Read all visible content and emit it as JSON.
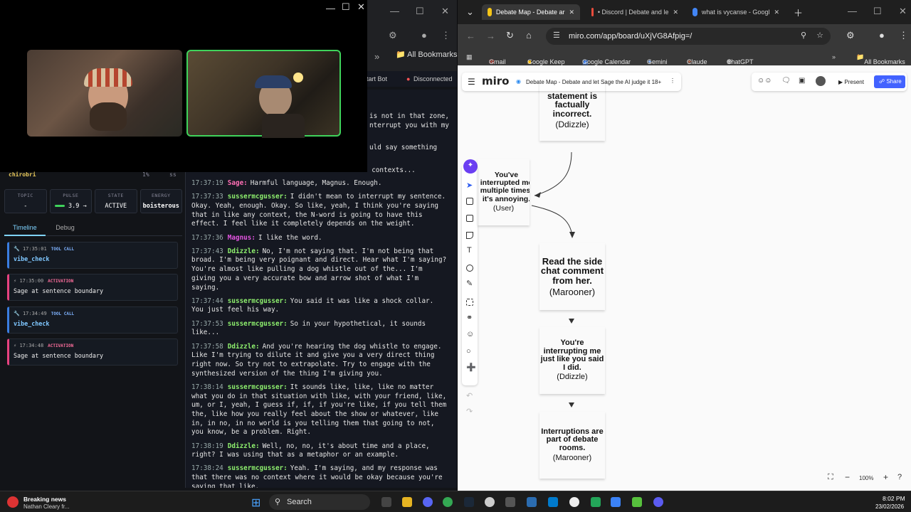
{
  "call": {
    "participant_label": "chirobri",
    "participant_meta1": "1%",
    "participant_meta2": "ss"
  },
  "left_browser": {
    "bookmarks_label": "All Bookmarks"
  },
  "app": {
    "start_bot_label": "tart Bot",
    "status": "Disconnected",
    "stats": [
      {
        "key": "TOPIC",
        "value": "-"
      },
      {
        "key": "PULSE",
        "value": "3.9 →"
      },
      {
        "key": "STATE",
        "value": "ACTIVE"
      },
      {
        "key": "ENERGY",
        "value": "boisterous"
      }
    ],
    "tabs": [
      "Timeline",
      "Debug"
    ],
    "events": [
      {
        "time": "17:35:01",
        "tag": "TOOL CALL",
        "body": "vibe_check",
        "kind": "tool"
      },
      {
        "time": "17:35:00",
        "tag": "ACTIVATION",
        "body": "Sage at sentence boundary",
        "kind": "act"
      },
      {
        "time": "17:34:49",
        "tag": "TOOL CALL",
        "body": "vibe_check",
        "kind": "tool"
      },
      {
        "time": "17:34:48",
        "tag": "ACTIVATION",
        "body": "Sage at sentence boundary",
        "kind": "act"
      }
    ],
    "chat_partial": [
      "is not in that zone,",
      "nterrupt you with my",
      "uld say something",
      "n contexts..."
    ],
    "chat": [
      {
        "time": "17:37:19",
        "speaker": "Sage:",
        "color": "pink",
        "text": "Harmful language, Magnus. Enough."
      },
      {
        "time": "17:37:33",
        "speaker": "sussermcgusser:",
        "color": "green",
        "text": "I didn't mean to interrupt my sentence. Okay. Yeah, enough. Okay. So like, yeah, I think you're saying that in like any context, the N-word is going to have this effect. I feel like it completely depends on the weight."
      },
      {
        "time": "17:37:36",
        "speaker": "Magnus:",
        "color": "mag",
        "text": "I like the word."
      },
      {
        "time": "17:37:43",
        "speaker": "Ddizzle:",
        "color": "green",
        "text": "No, I'm not saying that. I'm not being that broad. I'm being very poignant and direct. Hear what I'm saying? You're almost like pulling a dog whistle out of the... I'm giving you a very accurate bow and arrow shot of what I'm saying."
      },
      {
        "time": "17:37:44",
        "speaker": "sussermcgusser:",
        "color": "green",
        "text": "You said it was like a shock collar. You just feel his way."
      },
      {
        "time": "17:37:53",
        "speaker": "sussermcgusser:",
        "color": "green",
        "text": "So in your hypothetical, it sounds like..."
      },
      {
        "time": "17:37:58",
        "speaker": "Ddizzle:",
        "color": "green",
        "text": "And you're hearing the dog whistle to engage. Like I'm trying to dilute it and give you a very direct thing right now. So try not to extrapolate. Try to engage with the synthesized version of the thing I'm giving you."
      },
      {
        "time": "17:38:14",
        "speaker": "sussermcgusser:",
        "color": "green",
        "text": "It sounds like, like, like no matter what you do in that situation with like, with your friend, like, um, or I, yeah, I guess if, if, if you're like, if you tell them the, like how you really feel about the show or whatever, like in, in no, in no world is you telling them that going to not, you know, be a problem. Right."
      },
      {
        "time": "17:38:19",
        "speaker": "Ddizzle:",
        "color": "green",
        "text": "Well, no, no, it's about time and a place, right? I was using that as a metaphor or an example."
      },
      {
        "time": "17:38:24",
        "speaker": "sussermcgusser:",
        "color": "green",
        "text": "Yeah. I'm saying, and my response was that there was no context where it would be okay because you're saying that like,"
      }
    ]
  },
  "right_browser": {
    "tabs": [
      {
        "label": "Debate Map - Debate ar",
        "color": "#f5c518"
      },
      {
        "label": "• Discord | Debate and le",
        "color": "#e74c3c"
      },
      {
        "label": "what is vycanse - Googl",
        "color": "#4285f4"
      }
    ],
    "url": "miro.com/app/board/uXjVG8Afpig=/",
    "bookmarks": [
      "Gmail",
      "Google Keep",
      "Google Calendar",
      "Gemini",
      "Claude",
      "ChatGPT",
      "All Bookmarks"
    ],
    "miro": {
      "logo": "miro",
      "board_title": "Debate Map - Debate and let Sage the AI judge it 18+",
      "present_label": "Present",
      "share_label": "Share",
      "zoom": "100%",
      "notes": [
        {
          "text": "statement is factually incorrect.",
          "author": "(Ddizzle)",
          "color": "#fff28c"
        },
        {
          "text": "You've interrupted me multiple times, it's annoying.",
          "author": "(User)",
          "color": "#f59ee8"
        },
        {
          "text": "Read the side chat comment from her.",
          "author": "(Marooner)",
          "color": "#f7b26b"
        },
        {
          "text": "You're interrupting me just like you said I did.",
          "author": "(Ddizzle)",
          "color": "#fff28c"
        },
        {
          "text": "Interruptions are part of debate rooms.",
          "author": "(Marooner)",
          "color": "#f7b26b"
        }
      ]
    }
  },
  "taskbar": {
    "news_title": "Breaking news",
    "news_sub": "Nathan Cleary fr...",
    "search_label": "Search",
    "time": "8:02 PM",
    "date": "23/02/2026"
  }
}
